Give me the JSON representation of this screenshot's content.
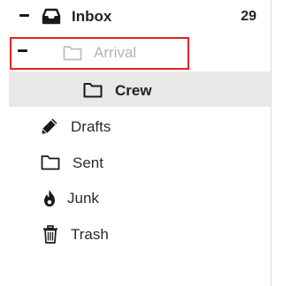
{
  "folders": {
    "inbox": {
      "label": "Inbox",
      "count": "29",
      "icon": "inbox-tray-icon",
      "expanded": true
    },
    "arrival": {
      "label": "Arrival",
      "icon": "folder-icon",
      "expanded": true,
      "dimmed": true
    },
    "crew": {
      "label": "Crew",
      "icon": "folder-icon",
      "selected": true
    },
    "drafts": {
      "label": "Drafts",
      "icon": "pencil-icon"
    },
    "sent": {
      "label": "Sent",
      "icon": "folder-icon"
    },
    "junk": {
      "label": "Junk",
      "icon": "fire-icon"
    },
    "trash": {
      "label": "Trash",
      "icon": "trash-can-icon"
    }
  },
  "colors": {
    "highlight_border": "#e32222",
    "selected_row": "#e8e8e8",
    "dimmed_text": "#b3b3b3"
  }
}
